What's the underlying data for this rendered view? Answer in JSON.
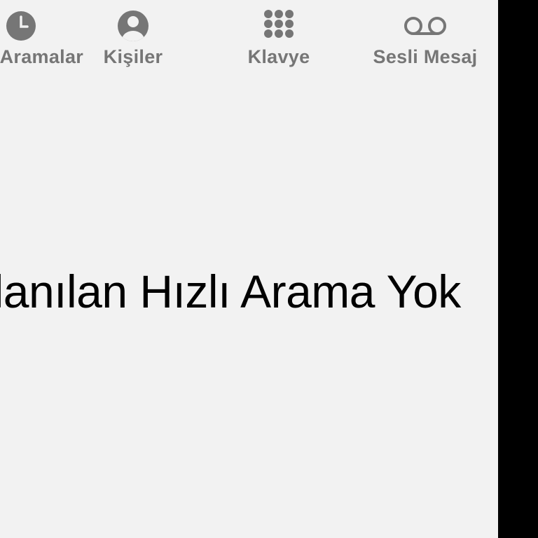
{
  "tab_bar": {
    "tabs": [
      {
        "label": "Son Aramalar",
        "icon": "clock-icon"
      },
      {
        "label": "Kişiler",
        "icon": "person-circle-icon"
      },
      {
        "label": "Klavye",
        "icon": "keypad-icon"
      },
      {
        "label": "Sesli Mesaj",
        "icon": "voicemail-icon"
      }
    ],
    "inactive_color": "#767676"
  },
  "content": {
    "empty_message": "Sık Kullanılan Hızlı Arama Yok"
  },
  "colors": {
    "background": "#f2f2f2",
    "text": "#000000"
  }
}
